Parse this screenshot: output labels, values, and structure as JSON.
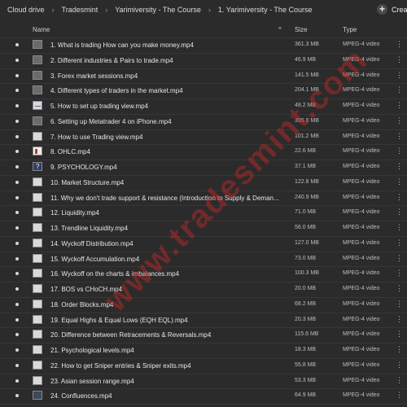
{
  "breadcrumbs": [
    "Cloud drive",
    "Tradesmint",
    "Yarimiversity - The Course",
    "1. Yarimiversity - The Course"
  ],
  "create_label": "Crea",
  "columns": {
    "name": "Name",
    "size": "Size",
    "type": "Type"
  },
  "watermark": "www.tradesmint.com",
  "rows": [
    {
      "name": "1. What is trading How can you make money.mp4",
      "size": "361.3 MB",
      "type": "MPEG-4 video",
      "thumb": "person"
    },
    {
      "name": "2. Different industries & Pairs to trade.mp4",
      "size": "46.9 MB",
      "type": "MPEG-4 video",
      "thumb": "person"
    },
    {
      "name": "3. Forex market sessions.mp4",
      "size": "141.5 MB",
      "type": "MPEG-4 video",
      "thumb": "person"
    },
    {
      "name": "4. Different types of traders in the market.mp4",
      "size": "204.1 MB",
      "type": "MPEG-4 video",
      "thumb": "person"
    },
    {
      "name": "5. How to set up trading view.mp4",
      "size": "48.2 MB",
      "type": "MPEG-4 video",
      "thumb": "chart"
    },
    {
      "name": "6. Setting up Metatrader 4 on iPhone.mp4",
      "size": "395.0 MB",
      "type": "MPEG-4 video",
      "thumb": "person"
    },
    {
      "name": "7. How to use Trading view.mp4",
      "size": "101.2 MB",
      "type": "MPEG-4 video",
      "thumb": "plain"
    },
    {
      "name": "8. OHLC.mp4",
      "size": "22.6 MB",
      "type": "MPEG-4 video",
      "thumb": "red"
    },
    {
      "name": "9. PSYCHOLOGY.mp4",
      "size": "37.1 MB",
      "type": "MPEG-4 video",
      "thumb": "q"
    },
    {
      "name": "10. Market Structure.mp4",
      "size": "122.8 MB",
      "type": "MPEG-4 video",
      "thumb": "plain"
    },
    {
      "name": "11. Why we don't trade support & resistance (Introduction to Supply & Deman...",
      "size": "240.9 MB",
      "type": "MPEG-4 video",
      "thumb": "plain"
    },
    {
      "name": "12. Liquidity.mp4",
      "size": "71.0 MB",
      "type": "MPEG-4 video",
      "thumb": "plain"
    },
    {
      "name": "13. Trendline Liquidity.mp4",
      "size": "56.0 MB",
      "type": "MPEG-4 video",
      "thumb": "plain"
    },
    {
      "name": "14. Wyckoff Distribution.mp4",
      "size": "127.0 MB",
      "type": "MPEG-4 video",
      "thumb": "plain"
    },
    {
      "name": "15. Wyckoff Accumulation.mp4",
      "size": "73.0 MB",
      "type": "MPEG-4 video",
      "thumb": "plain"
    },
    {
      "name": "16. Wyckoff on the charts & imbalances.mp4",
      "size": "100.3 MB",
      "type": "MPEG-4 video",
      "thumb": "plain"
    },
    {
      "name": "17. BOS vs CHoCH.mp4",
      "size": "20.0 MB",
      "type": "MPEG-4 video",
      "thumb": "plain"
    },
    {
      "name": "18. Order Blocks.mp4",
      "size": "68.2 MB",
      "type": "MPEG-4 video",
      "thumb": "plain"
    },
    {
      "name": "19. Equal Highs & Equal Lows (EQH EQL).mp4",
      "size": "20.3 MB",
      "type": "MPEG-4 video",
      "thumb": "plain"
    },
    {
      "name": "20. Difference between Retracements & Reversals.mp4",
      "size": "115.6 MB",
      "type": "MPEG-4 video",
      "thumb": "plain"
    },
    {
      "name": "21. Psychological levels.mp4",
      "size": "18.3 MB",
      "type": "MPEG-4 video",
      "thumb": "plain"
    },
    {
      "name": "22. How to get Sniper entries & Sniper exits.mp4",
      "size": "55.8 MB",
      "type": "MPEG-4 video",
      "thumb": "plain"
    },
    {
      "name": "23. Asian session range.mp4",
      "size": "53.3 MB",
      "type": "MPEG-4 video",
      "thumb": "plain"
    },
    {
      "name": "24. Confluences.mp4",
      "size": "64.9 MB",
      "type": "MPEG-4 video",
      "thumb": "dark"
    }
  ]
}
